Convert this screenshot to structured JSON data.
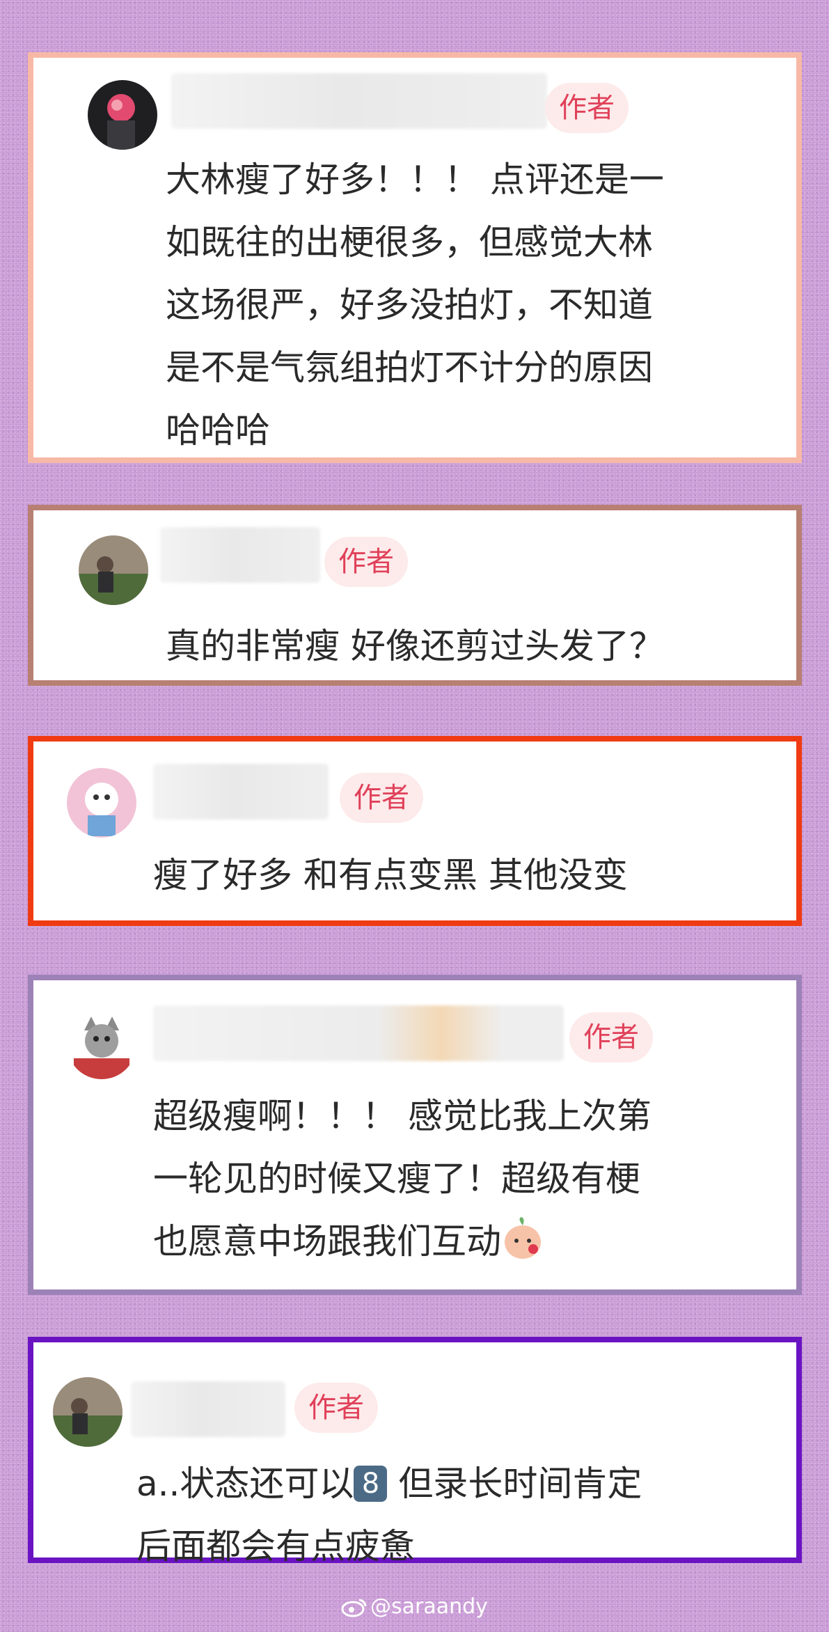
{
  "author_badge_label": "作者",
  "comments": [
    {
      "lines": [
        "大林瘦了好多！！！ 点评还是一",
        "如既往的出梗很多，但感觉大林",
        "这场很严，好多没拍灯，不知道",
        "是不是气氛组拍灯不计分的原因",
        "哈哈哈"
      ],
      "border_color": "#f7b9a6"
    },
    {
      "lines": [
        "真的非常瘦 好像还剪过头发了？"
      ],
      "border_color": "#b88073"
    },
    {
      "lines": [
        "瘦了好多 和有点变黑 其他没变"
      ],
      "border_color": "#f03b12"
    },
    {
      "lines": [
        "超级瘦啊！！！ 感觉比我上次第",
        "一轮见的时候又瘦了！超级有梗",
        "也愿意中场跟我们互动"
      ],
      "border_color": "#9d82b8",
      "trailing_icon": "peach-face-emoji"
    },
    {
      "lines": [
        "后面都会有点疲惫"
      ],
      "first_line_prefix": "a..状态还可以",
      "keycap": "8",
      "first_line_suffix": " 但录长时间肯定",
      "border_color": "#6a13c2"
    }
  ],
  "watermark": {
    "icon": "weibo-icon",
    "text": "@saraandy"
  }
}
